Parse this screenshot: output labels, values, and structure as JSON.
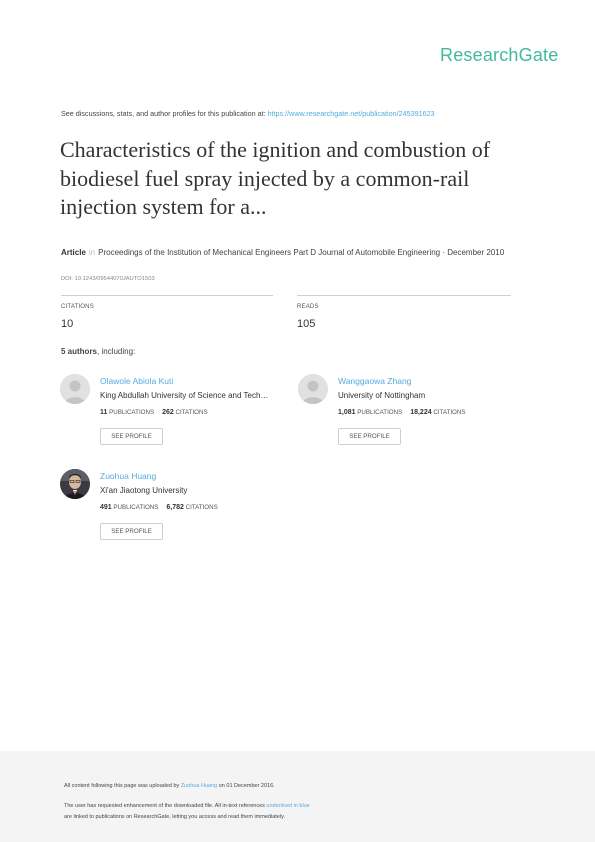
{
  "brand": "ResearchGate",
  "discussion": {
    "prefix": "See discussions, stats, and author profiles for this publication at:",
    "url": "https://www.researchgate.net/publication/245391623"
  },
  "paper": {
    "title": "Characteristics of the ignition and combustion of biodiesel fuel spray injected by a common-rail injection system for a...",
    "type": "Article",
    "separator": "in",
    "journal": "Proceedings of the Institution of Mechanical Engineers Part D Journal of Automobile Engineering · December 2010",
    "doi": "DOI: 10.1243/09544070JAUTO1503"
  },
  "stats": {
    "citations_label": "CITATIONS",
    "citations_value": "10",
    "reads_label": "READS",
    "reads_value": "105"
  },
  "authors_heading": {
    "count": "5 authors",
    "suffix": ", including:"
  },
  "authors": [
    {
      "name": "Olawole Abiola Kuti",
      "institution": "King Abdullah University of Science and Tech…",
      "publications": "11",
      "citations": "262",
      "publications_label": "PUBLICATIONS",
      "citations_label": "CITATIONS",
      "button": "SEE PROFILE",
      "avatar": "placeholder-avatar-icon"
    },
    {
      "name": "Wanggaowa Zhang",
      "institution": "University of Nottingham",
      "publications": "1,081",
      "citations": "18,224",
      "publications_label": "PUBLICATIONS",
      "citations_label": "CITATIONS",
      "button": "SEE PROFILE",
      "avatar": "placeholder-avatar-icon"
    },
    {
      "name": "Zuohua Huang",
      "institution": "Xi'an Jiaotong University",
      "publications": "491",
      "citations": "6,782",
      "publications_label": "PUBLICATIONS",
      "citations_label": "CITATIONS",
      "button": "SEE PROFILE",
      "avatar": "photo-avatar"
    }
  ],
  "footer": {
    "uploaded_prefix": "All content following this page was uploaded by",
    "uploader": "Zuohua Huang",
    "uploaded_suffix": "on 01 December 2016.",
    "line2_prefix": "The user has requested enhancement of the downloaded file. All in-text references",
    "line2_link": "underlined in blue",
    "line3": "are linked to publications on ResearchGate, letting you access and read them immediately."
  },
  "colors": {
    "brand": "#40ba9b",
    "link": "#55aadd",
    "footer_bg": "#f4f4f4"
  }
}
